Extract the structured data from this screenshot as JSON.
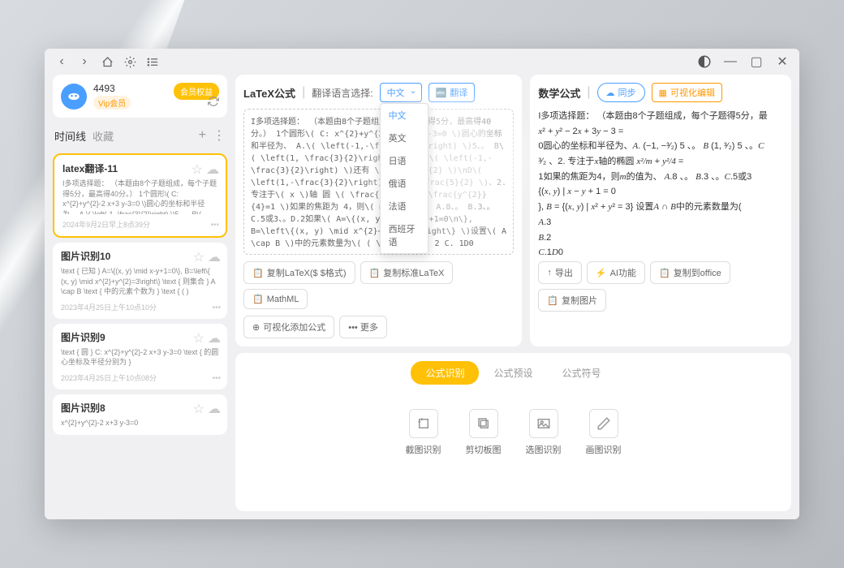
{
  "titlebar": {
    "back_icon": "‹",
    "fwd_icon": "›"
  },
  "user": {
    "id": "4493",
    "vip": "Vip会员",
    "member_btn": "会员权益"
  },
  "timeline": {
    "tab_active": "时间线",
    "tab_inactive": "收藏",
    "items": [
      {
        "title": "latex翻译-11",
        "body": "I多项选择题： （本题由8个子题组成，每个子题得5分，最高得40分。） 1个圆形\\( C: x^{2}+y^{2}-2 x+3 y-3=0 \\)圆心的坐标和半径为、 A.\\( \\left(-1,-\\frac{3}{2}\\right) \\)5、。 B\\( \\left(1, \\frac{3}{2}...",
        "time": "2024年9月2日早上8点39分"
      },
      {
        "title": "图片识别10",
        "body": "\\text { 已知 } A=\\{(x, y) \\mid x-y+1=0\\}, B=\\left\\{ (x, y) \\mid x^{2}+y^{2}=3\\right\\} \\text { 则集合 } A \\cap B \\text { 中的元素个数为 } \\text { ( )",
        "time": "2023年4月25日上午10点10分"
      },
      {
        "title": "图片识别9",
        "body": "\\text { 圆 } C: x^{2}+y^{2}-2 x+3 y-3=0 \\text { 的圆心坐标及半径分别为 }",
        "time": "2023年4月25日上午10点08分"
      },
      {
        "title": "图片识别8",
        "body": "x^{2}+y^{2}-2 x+3 y-3=0",
        "time": ""
      }
    ]
  },
  "latex_panel": {
    "title": "LaTeX公式",
    "lang_label": "翻译语言选择:",
    "lang_selected": "中文",
    "lang_options": [
      "中文",
      "英文",
      "日语",
      "俄语",
      "法语",
      "西班牙语"
    ],
    "translate_btn": "翻译",
    "content": "I多项选择题： （本题由8个子题组成，每个子题得5分，最高得40分。） 1个圆形\\( C: x^{2}+y^{2}-2 x+3 y-3=0 \\)圆心的坐标和半径为、 A.\\( \\left(-1,-\\frac{3}{2}\\right) \\)5、。 B\\( \\left(1, \\frac{3}{2}\\right) \\)5、。C\\( \\left(-1,-\\frac{3}{2}\\right) \\)还有 \\( \\frac{5}{2} \\)\\nD\\( \\left(1,-\\frac{3}{2}\\right) \\)和\\( \\frac{5}{2} \\)、2. 专注于\\( x \\)轴 圆 \\( \\frac{x^{2}}{m}+\\frac{y^{2}}{4}=1 \\)如果的焦距为 4，则\\( m \\)的值为、 A.8、。 B.3、。C.5或3、。D.2如果\\( A=\\{(x, y) \\mid x-y+1=0\\n\\}, B=\\left\\{(x, y) \\mid x^{2}+y^{2}=3\\right\\} \\)设置\\( A \\cap B \\)中的元素数量为\\( ( \\)\\nA. 3\nB. 2\nC. 1D0",
    "buttons": {
      "copy_latex": "复制LaTeX($ $格式)",
      "copy_std": "复制标准LaTeX",
      "mathml": "MathML",
      "visual_add": "可视化添加公式",
      "more": "••• 更多"
    }
  },
  "math_panel": {
    "title": "数学公式",
    "sync_btn": "同步",
    "edit_btn": "可视化编辑",
    "content_line1": "I多项选择题： （本题由8个子题组成，每个子题得5分，最",
    "buttons": {
      "export": "导出",
      "ai": "AI功能",
      "copy_office": "复制到office",
      "copy_img": "复制图片"
    }
  },
  "bottom": {
    "tabs": [
      "公式识别",
      "公式预设",
      "公式符号"
    ],
    "actions": [
      {
        "label": "截图识别"
      },
      {
        "label": "剪切板图"
      },
      {
        "label": "选图识别"
      },
      {
        "label": "画图识别"
      }
    ]
  }
}
